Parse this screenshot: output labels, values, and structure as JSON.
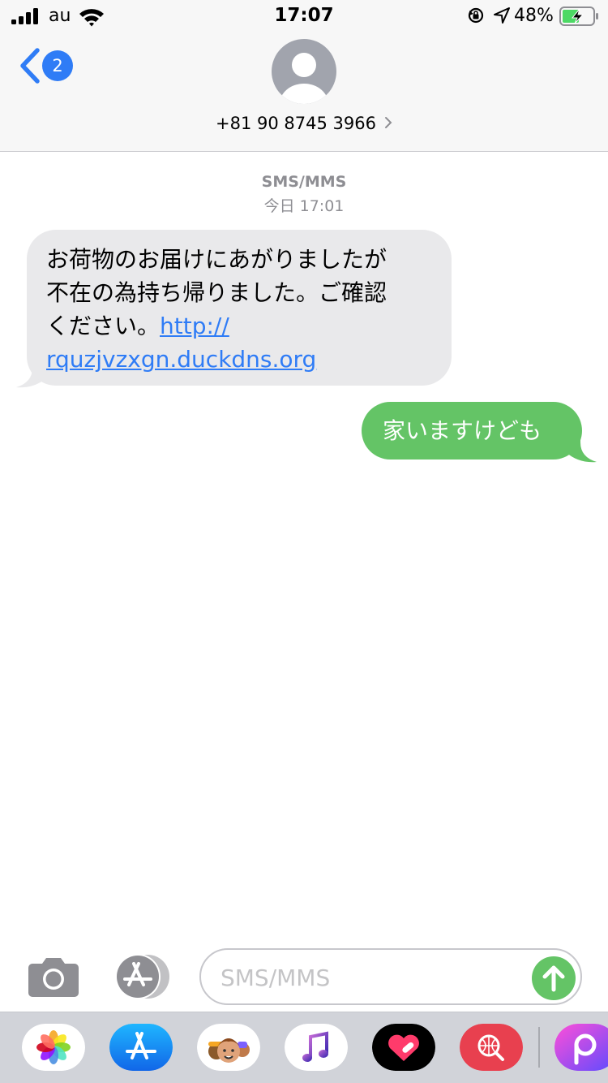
{
  "status_bar": {
    "carrier": "au",
    "time": "17:07",
    "battery_percent": "48%",
    "icons": [
      "signal-bars-icon",
      "wifi-icon",
      "orientation-lock-icon",
      "location-arrow-icon",
      "battery-charging-icon"
    ]
  },
  "header": {
    "back_badge": "2",
    "contact_number": "+81 90 8745 3966",
    "avatar_icon": "person-silhouette-icon"
  },
  "conversation": {
    "service": "SMS/MMS",
    "timestamp": "今日 17:01",
    "incoming": {
      "line1": "お荷物のお届けにあがりましたが",
      "line2": "不在の為持ち帰りました。ご確認",
      "line3_text": "ください。",
      "link_part1": "http://",
      "link_part2": "rquzjvzxgn.duckdns.org"
    },
    "outgoing": {
      "text": "家いますけども"
    }
  },
  "input_bar": {
    "placeholder": "SMS/MMS",
    "value": ""
  },
  "app_drawer": {
    "apps": [
      "photos-app-icon",
      "app-store-app-icon",
      "memoji-app-icon",
      "music-app-icon",
      "heart-app-icon",
      "web-search-app-icon",
      "picsart-app-icon"
    ]
  },
  "colors": {
    "accent_blue": "#2f7cf6",
    "sent_bubble": "#64c466",
    "received_bubble": "#e9e9eb",
    "header_bg": "#f7f7f7",
    "drawer_bg": "#d1d3d9"
  }
}
